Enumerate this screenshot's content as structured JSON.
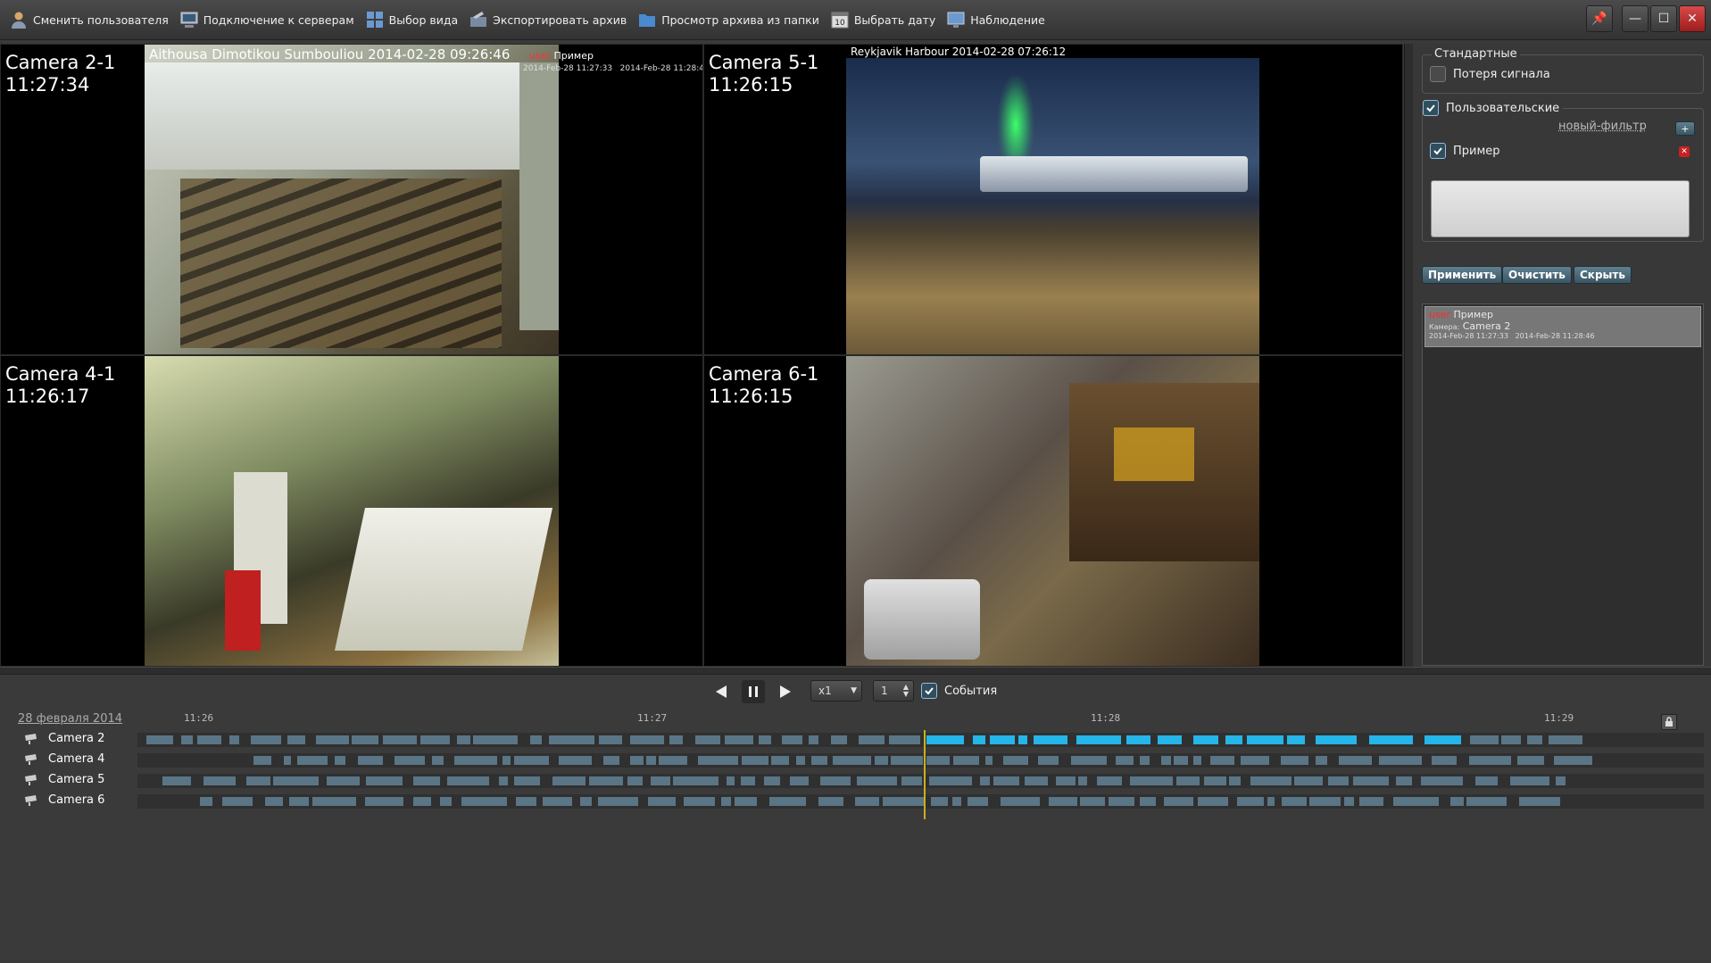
{
  "toolbar": {
    "buttons": [
      {
        "label": "Сменить пользователя",
        "icon": "user-icon"
      },
      {
        "label": "Подключение к серверам",
        "icon": "server-connect-icon"
      },
      {
        "label": "Выбор вида",
        "icon": "layout-grid-icon"
      },
      {
        "label": "Экспортировать архив",
        "icon": "export-archive-icon"
      },
      {
        "label": "Просмотр архива из папки",
        "icon": "folder-icon"
      },
      {
        "label": "Выбрать дату",
        "icon": "calendar-icon"
      },
      {
        "label": "Наблюдение",
        "icon": "monitor-icon"
      }
    ],
    "calendar_day": "10"
  },
  "cameras": [
    {
      "name": "Camera 2-1",
      "time": "11:27:34",
      "overlay": "Aithousa Dimotikou Sumbouliou 2014-02-28 09:26:46",
      "event_name": "Пример",
      "event_start": "2014-Feb-28 11:27:33",
      "event_end": "2014-Feb-28 11:28:46"
    },
    {
      "name": "Camera 5-1",
      "time": "11:26:15",
      "overlay": "Reykjavik Harbour 2014-02-28 07:26:12"
    },
    {
      "name": "Camera 4-1",
      "time": "11:26:17"
    },
    {
      "name": "Camera 6-1",
      "time": "11:26:15"
    }
  ],
  "panel": {
    "standard_group": "Стандартные",
    "signal_loss": "Потеря сигнала",
    "custom_group": "Пользовательские",
    "new_filter_link": "новый-фильтр",
    "add_button": "+",
    "filter_item": "Пример",
    "apply": "Применить",
    "clear": "Очистить",
    "hide": "Скрыть",
    "event": {
      "user_tag": "user",
      "name": "Пример",
      "camera_label": "Камера:",
      "camera": "Camera 2",
      "start": "2014-Feb-28 11:27:33",
      "end": "2014-Feb-28 11:28:46"
    }
  },
  "playback": {
    "speed": "x1",
    "step": "1",
    "events_label": "События"
  },
  "timeline": {
    "date": "28 февраля 2014",
    "ticks": [
      "11:26",
      "11:27",
      "11:28",
      "11:29"
    ],
    "tracks": [
      "Camera 2",
      "Camera 4",
      "Camera 5",
      "Camera 6"
    ]
  },
  "colors": {
    "accent_segment": "#26b5e8",
    "segment": "#5a7585",
    "cursor": "#c8b020",
    "event_user": "#ff2a2a"
  }
}
